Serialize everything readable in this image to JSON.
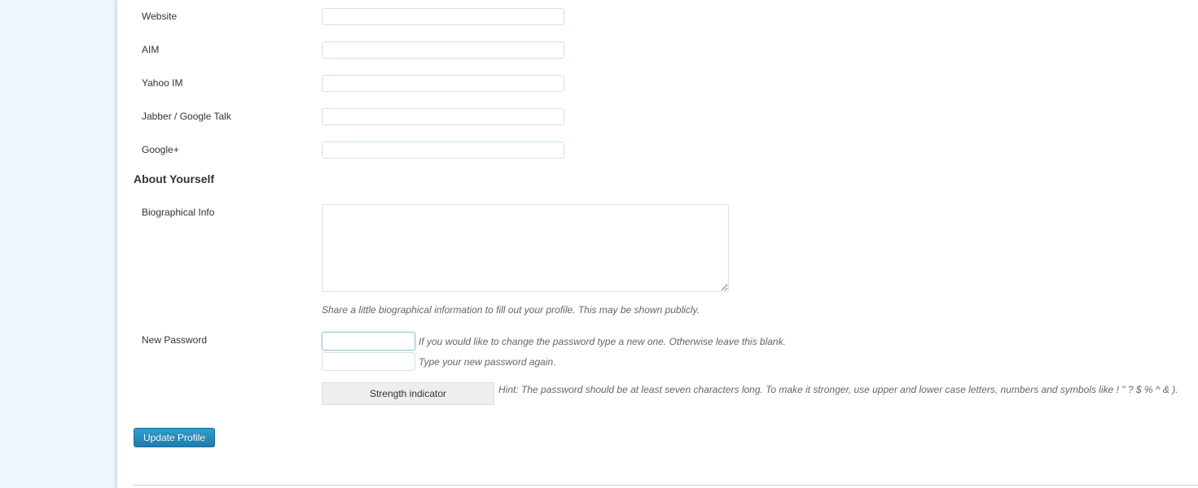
{
  "contact_fields": [
    {
      "label": "Website",
      "value": ""
    },
    {
      "label": "AIM",
      "value": ""
    },
    {
      "label": "Yahoo IM",
      "value": ""
    },
    {
      "label": "Jabber / Google Talk",
      "value": ""
    },
    {
      "label": "Google+",
      "value": ""
    }
  ],
  "about": {
    "section_title": "About Yourself",
    "bio_label": "Biographical Info",
    "bio_value": "",
    "bio_description": "Share a little biographical information to fill out your profile. This may be shown publicly."
  },
  "password": {
    "label": "New Password",
    "new_value": "",
    "new_description": "If you would like to change the password type a new one. Otherwise leave this blank.",
    "confirm_value": "",
    "confirm_description": "Type your new password again.",
    "strength_label": "Strength indicator",
    "hint": "Hint: The password should be at least seven characters long. To make it stronger, use upper and lower case letters, numbers and symbols like ! \" ? $ % ^ & )."
  },
  "actions": {
    "update_label": "Update Profile"
  },
  "colors": {
    "primary_button": "#2386b9",
    "input_border": "#cfe3ea",
    "page_background": "#eef5fc"
  }
}
